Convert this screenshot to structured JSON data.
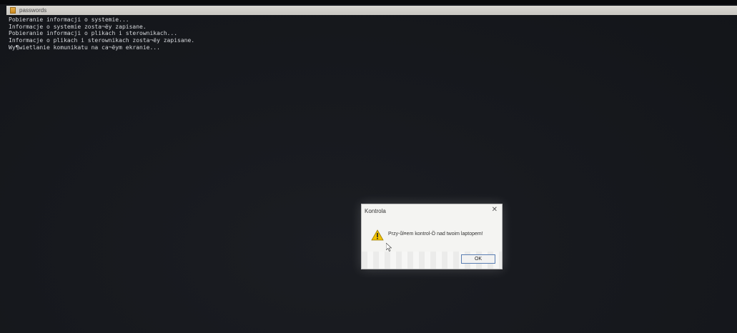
{
  "window": {
    "title": "passwords"
  },
  "console": {
    "lines": [
      "Pobieranie informacji o systemie...",
      "Informacje o systemie zosta¬ëy zapisane.",
      "Pobieranie informacji o plikach i sterownikach...",
      "Informacje o plikach i sterownikach zosta¬ëy zapisane.",
      "Wy¶wietlanie komunikatu na ca¬ëym ekranie..."
    ]
  },
  "dialog": {
    "title": "Kontrola",
    "message": "Przy-ůl¤em kontrol-Ö nad twoim laptopem!",
    "ok_label": "OK",
    "close_glyph": "✕",
    "icon": "warning-icon"
  },
  "colors": {
    "background": "#17191e",
    "console_text": "#d6d8dc",
    "dialog_bg": "#f4f4f2",
    "warning": "#f2c200",
    "ok_border": "#5b7fb3"
  }
}
